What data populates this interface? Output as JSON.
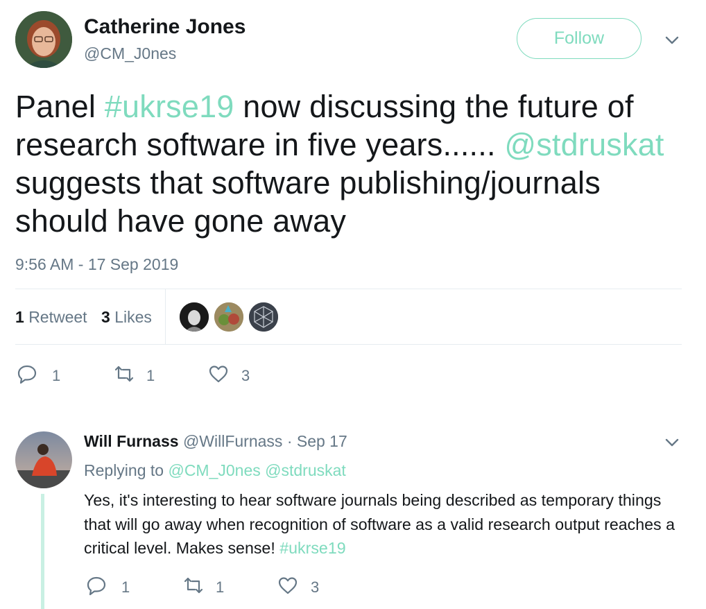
{
  "tweet": {
    "author": {
      "name": "Catherine Jones",
      "handle": "@CM_J0nes"
    },
    "follow_label": "Follow",
    "text_parts": [
      {
        "t": "Panel ",
        "link": false
      },
      {
        "t": "#ukrse19",
        "link": true
      },
      {
        "t": " now discussing the future of research software in five years...... ",
        "link": false
      },
      {
        "t": "@stdruskat",
        "link": true
      },
      {
        "t": " suggests that software publishing/journals should have gone away",
        "link": false
      }
    ],
    "timestamp": "9:56 AM - 17 Sep 2019",
    "stats": {
      "retweets_count": "1",
      "retweets_label": "Retweet",
      "likes_count": "3",
      "likes_label": "Likes"
    },
    "actions": {
      "reply_count": "1",
      "retweet_count": "1",
      "like_count": "3"
    }
  },
  "reply": {
    "author": {
      "name": "Will Furnass",
      "handle": "@WillFurnass",
      "date": "· Sep 17"
    },
    "replying_to_label": "Replying to",
    "replying_to": [
      "@CM_J0nes",
      "@stdruskat"
    ],
    "text": "Yes, it's interesting to hear software journals being described as temporary things that will go away when recognition of software as a valid research output reaches a critical level. Makes sense! ",
    "hashtag": "#ukrse19",
    "actions": {
      "reply_count": "1",
      "retweet_count": "1",
      "like_count": "3"
    }
  },
  "colors": {
    "accent": "#7fdbbe",
    "muted": "#657786",
    "text": "#14171a",
    "divider": "#e6ecf0"
  }
}
